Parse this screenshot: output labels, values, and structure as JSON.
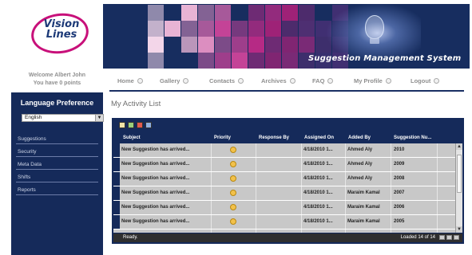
{
  "logo": {
    "line1": "Vision",
    "line2": "Lines"
  },
  "banner": {
    "title": "Suggestion Management System"
  },
  "welcome": {
    "line1": "Welcome Albert John",
    "line2": "You have 0 points"
  },
  "nav": [
    "Home",
    "Gallery",
    "Contacts",
    "Archives",
    "FAQ",
    "My Profile",
    "Logout"
  ],
  "sidebar": {
    "title": "Language Preference",
    "language": "English",
    "items": [
      "Suggestions",
      "Security",
      "Meta Data",
      "Shifts",
      "Reports"
    ]
  },
  "page": {
    "title": "My Activity List"
  },
  "grid": {
    "columns": [
      "Subject",
      "Priority",
      "Response By",
      "Assigned On",
      "Added By",
      "Suggestion Nu..."
    ],
    "rows": [
      {
        "subject": "New Suggestion has arrived...",
        "assigned": "4/18/2010 1...",
        "added_by": "Ahmed Aly",
        "number": "2010"
      },
      {
        "subject": "New Suggestion has arrived...",
        "assigned": "4/18/2010 1...",
        "added_by": "Ahmed Aly",
        "number": "2009"
      },
      {
        "subject": "New Suggestion has arrived...",
        "assigned": "4/18/2010 1...",
        "added_by": "Ahmed Aly",
        "number": "2008"
      },
      {
        "subject": "New Suggestion has arrived...",
        "assigned": "4/18/2010 1...",
        "added_by": "Maraim Kamal",
        "number": "2007"
      },
      {
        "subject": "New Suggestion has arrived...",
        "assigned": "4/18/2010 1...",
        "added_by": "Maraim Kamal",
        "number": "2006"
      },
      {
        "subject": "New Suggestion has arrived...",
        "assigned": "4/18/2010 1...",
        "added_by": "Maraim Kamal",
        "number": "2005"
      }
    ],
    "status": "Ready.",
    "loaded": "Loaded 14 of 14"
  },
  "colors": {
    "navy": "#152a5a",
    "magenta": "#c8107a",
    "row_bg": "#c8c8c8",
    "priority": "#f2c14a"
  },
  "icons": [
    "search-icon",
    "refresh-icon",
    "export-icon",
    "print-icon",
    "priority-icon"
  ]
}
